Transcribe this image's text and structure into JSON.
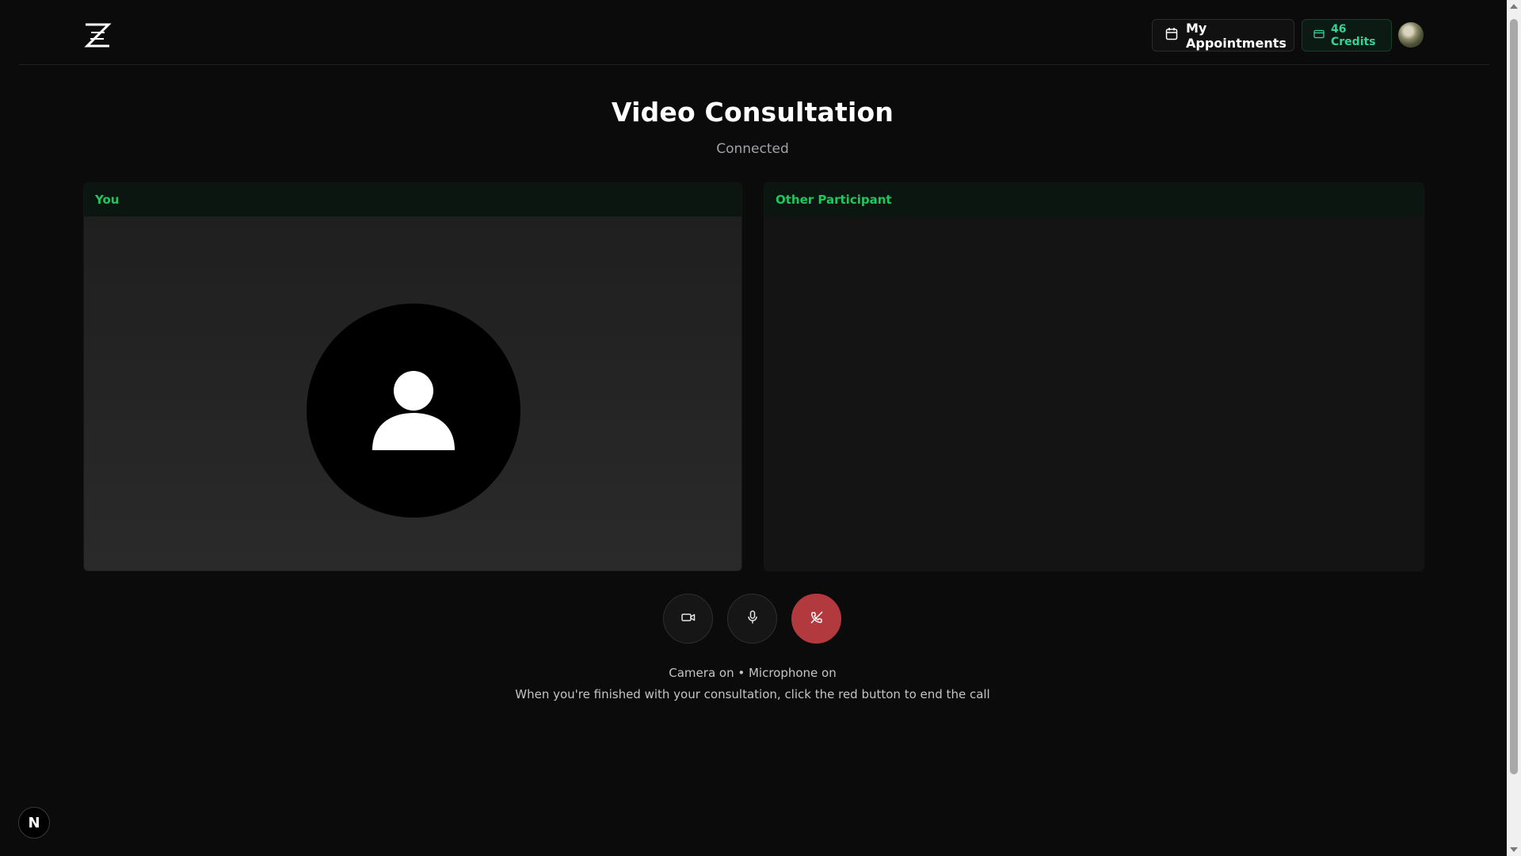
{
  "header": {
    "appointments_label": "My Appointments",
    "credits_label": "46 Credits"
  },
  "page": {
    "title": "Video Consultation",
    "status": "Connected"
  },
  "panels": {
    "self_label": "You",
    "other_label": "Other Participant"
  },
  "controls": {
    "camera_icon": "video-camera-icon",
    "mic_icon": "microphone-icon",
    "end_icon": "phone-off-icon"
  },
  "footer": {
    "state": "Camera on • Microphone on",
    "hint": "When you're finished with your consultation, click the red button to end the call"
  },
  "badge": {
    "letter": "N"
  },
  "colors": {
    "accent": "#22c55e",
    "end_call": "#b23a3e",
    "background": "#0b0b0b"
  }
}
